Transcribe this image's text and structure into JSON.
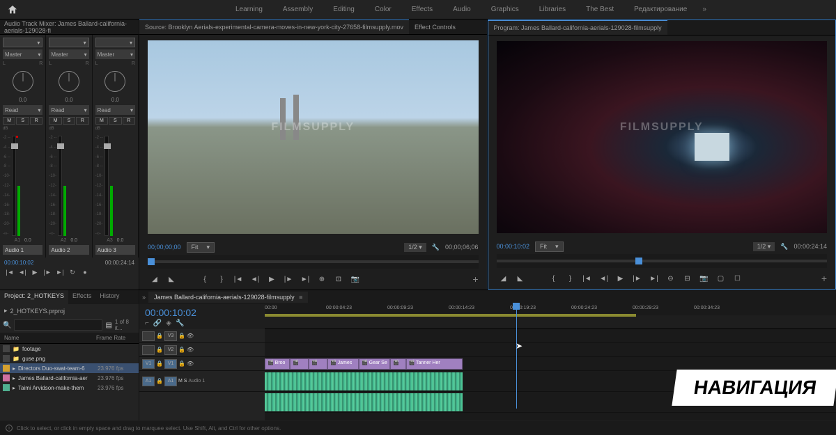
{
  "topbar": {
    "workspaces": [
      "Learning",
      "Assembly",
      "Editing",
      "Color",
      "Effects",
      "Audio",
      "Graphics",
      "Libraries",
      "The Best",
      "Редактирование"
    ]
  },
  "audioMixer": {
    "title": "Audio Track Mixer: James Ballard-california-aerials-129028-fi",
    "masterLabel": "Master",
    "readLabel": "Read",
    "msrLabels": [
      "M",
      "S",
      "R"
    ],
    "dbLabel": "dB",
    "scale": [
      "-2 --",
      "-4 --",
      "-6 --",
      "-8 --",
      "-10-",
      "-12-",
      "-14-",
      "-16-",
      "-18-",
      "-20-",
      "-∞-"
    ],
    "channels": [
      {
        "name": "Audio 1",
        "val": "0.0",
        "route": "A1"
      },
      {
        "name": "Audio 2",
        "val": "0.0",
        "route": "A2"
      },
      {
        "name": "Audio 3",
        "val": "0.0",
        "route": "A3"
      }
    ],
    "tc1": "00:00:10:02",
    "tc2": "00:00:24:14"
  },
  "source": {
    "tabLabel": "Source: Brooklyn Aerials-experimental-camera-moves-in-new-york-city-27658-filmsupply.mov",
    "effectsTab": "Effect Controls",
    "watermark": "FILMSUPPLY",
    "tc": "00;00;00;00",
    "fit": "Fit",
    "half": "1/2",
    "dur": "00;00;06;06"
  },
  "program": {
    "tabLabel": "Program: James Ballard-california-aerials-129028-filmsupply",
    "watermark": "FILMSUPPLY",
    "tc": "00:00:10:02",
    "fit": "Fit",
    "half": "1/2",
    "dur": "00:00:24:14"
  },
  "project": {
    "tabs": [
      "Project: 2_HOTKEYS",
      "Effects",
      "History"
    ],
    "name": "2_HOTKEYS.prproj",
    "count": "1 of 8 it...",
    "headers": {
      "name": "Name",
      "frameRate": "Frame Rate"
    },
    "items": [
      {
        "name": "footage",
        "fr": "",
        "type": "fld"
      },
      {
        "name": "guse.png",
        "fr": "",
        "type": "fld"
      },
      {
        "name": "Directors Duo-swat-team-6",
        "fr": "23.976 fps",
        "type": "gold",
        "sel": true
      },
      {
        "name": "James Ballard-california-aer",
        "fr": "23.976 fps",
        "type": "pink"
      },
      {
        "name": "Taimi Arvidson-make-them",
        "fr": "23.976 fps",
        "type": "teal"
      }
    ]
  },
  "timeline": {
    "tabLabel": "James Ballard-california-aerials-129028-filmsupply",
    "tc": "00:00:10:02",
    "ticks": [
      {
        "t": "00:00",
        "pos": 0
      },
      {
        "t": "00:00:04:23",
        "pos": 22
      },
      {
        "t": "00:00:09:23",
        "pos": 44
      },
      {
        "t": "00:00:14:23",
        "pos": 66
      },
      {
        "t": "00:00:19:23",
        "pos": 88
      },
      {
        "t": "00:00:24:23",
        "pos": 110
      },
      {
        "t": "00:00:29:23",
        "pos": 132
      },
      {
        "t": "00:00:34:23",
        "pos": 154
      }
    ],
    "videoTracks": [
      "V3",
      "V2",
      "V1"
    ],
    "audioTracks": [
      "A1"
    ],
    "audioLabel": "Audio 1",
    "clips": [
      {
        "name": "Broo",
        "start": 0,
        "w": 8
      },
      {
        "name": "",
        "start": 8,
        "w": 6
      },
      {
        "name": "",
        "start": 14,
        "w": 6
      },
      {
        "name": "James",
        "start": 20,
        "w": 10
      },
      {
        "name": "Gear Se",
        "start": 30,
        "w": 10
      },
      {
        "name": "",
        "start": 40,
        "w": 5
      },
      {
        "name": "Tanner Her",
        "start": 45,
        "w": 18
      }
    ]
  },
  "banner": "НАВИГАЦИЯ",
  "hint": "Click to select, or click in empty space and drag to marquee select. Use Shift, Alt, and Ctrl for other options."
}
